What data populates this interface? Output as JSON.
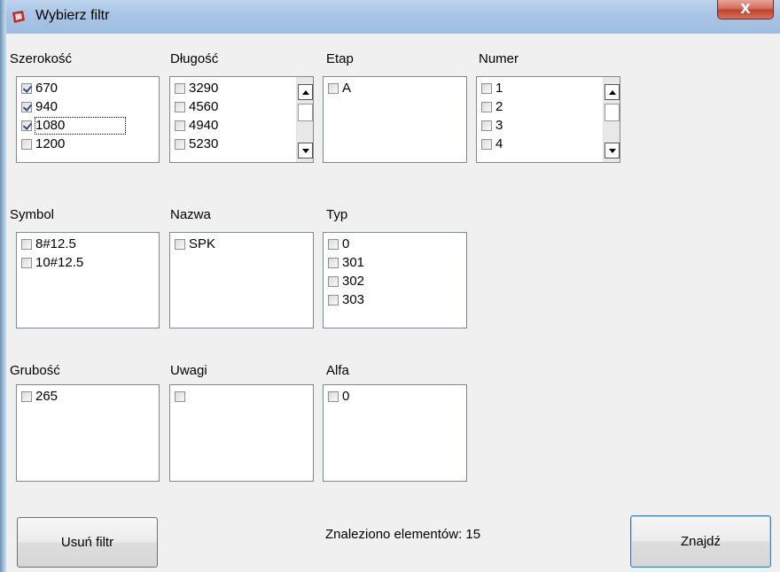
{
  "window": {
    "title": "Wybierz filtr",
    "close_label": "X",
    "accent": "#c0392b"
  },
  "groups": {
    "szerokosc": {
      "label": "Szerokość",
      "items": [
        {
          "text": "670",
          "checked": true
        },
        {
          "text": "940",
          "checked": true
        },
        {
          "text": "1080",
          "checked": true
        },
        {
          "text": "1200",
          "checked": false
        }
      ]
    },
    "dlugosc": {
      "label": "Długość",
      "items": [
        {
          "text": "3290",
          "checked": false
        },
        {
          "text": "4560",
          "checked": false
        },
        {
          "text": "4940",
          "checked": false
        },
        {
          "text": "5230",
          "checked": false
        }
      ]
    },
    "etap": {
      "label": "Etap",
      "items": [
        {
          "text": "A",
          "checked": false
        }
      ]
    },
    "numer": {
      "label": "Numer",
      "items": [
        {
          "text": "1",
          "checked": false
        },
        {
          "text": "2",
          "checked": false
        },
        {
          "text": "3",
          "checked": false
        },
        {
          "text": "4",
          "checked": false
        }
      ]
    },
    "symbol": {
      "label": "Symbol",
      "items": [
        {
          "text": "8#12.5",
          "checked": false
        },
        {
          "text": "10#12.5",
          "checked": false
        }
      ]
    },
    "nazwa": {
      "label": "Nazwa",
      "items": [
        {
          "text": "SPK",
          "checked": false
        }
      ]
    },
    "typ": {
      "label": "Typ",
      "items": [
        {
          "text": "0",
          "checked": false
        },
        {
          "text": "301",
          "checked": false
        },
        {
          "text": "302",
          "checked": false
        },
        {
          "text": "303",
          "checked": false
        }
      ]
    },
    "grubosc": {
      "label": "Grubość",
      "items": [
        {
          "text": "265",
          "checked": false
        }
      ]
    },
    "uwagi": {
      "label": "Uwagi",
      "items": [
        {
          "text": "",
          "checked": false
        }
      ]
    },
    "alfa": {
      "label": "Alfa",
      "items": [
        {
          "text": "0",
          "checked": false
        }
      ]
    }
  },
  "footer": {
    "clear_label": "Usuń filtr",
    "status": "Znaleziono elementów: 15",
    "find_label": "Znajdź"
  }
}
